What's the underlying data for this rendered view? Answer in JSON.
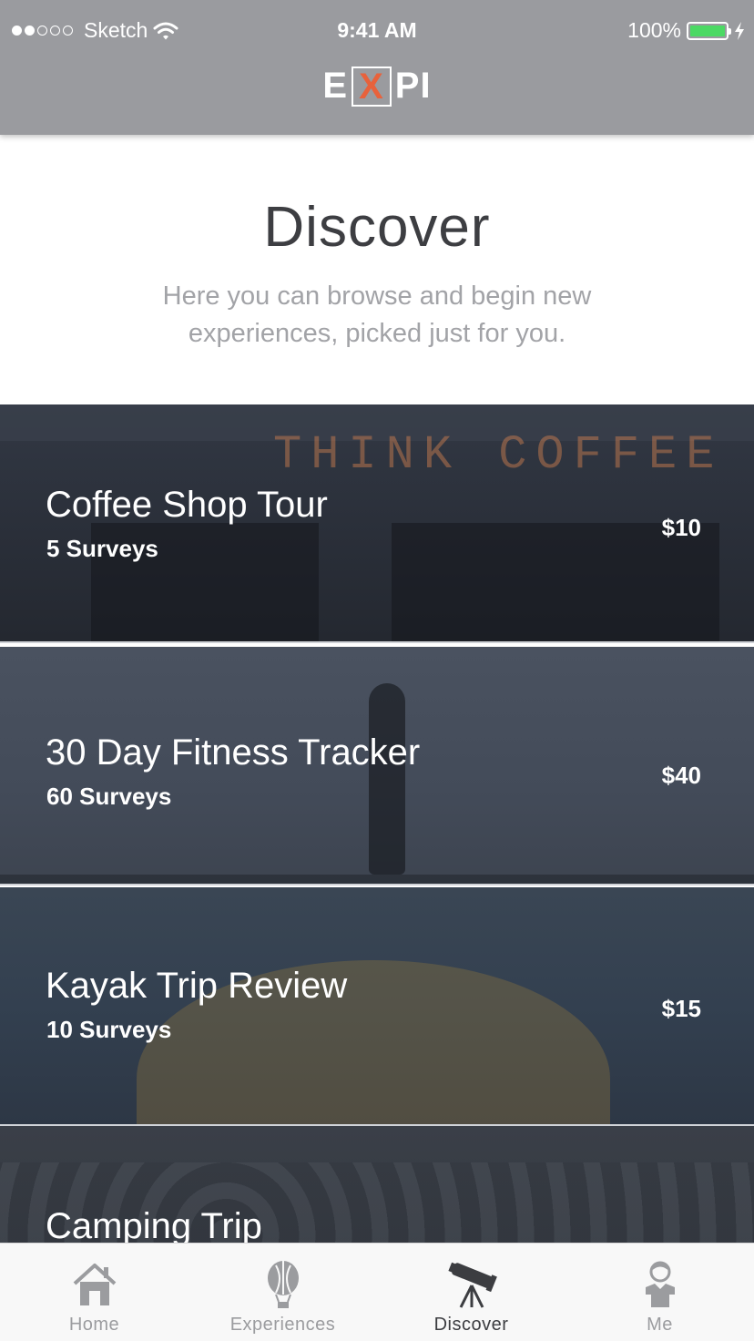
{
  "status_bar": {
    "carrier": "Sketch",
    "time": "9:41 AM",
    "battery": "100%"
  },
  "header": {
    "logo": {
      "left": "E",
      "boxed": "X",
      "right": "PI"
    }
  },
  "intro": {
    "title": "Discover",
    "description": "Here you can browse and begin new experiences, picked just for you."
  },
  "experiences": [
    {
      "title": "Coffee Shop Tour",
      "surveys": "5 Surveys",
      "price": "$10",
      "image_text": "THINK COFFEE"
    },
    {
      "title": "30 Day Fitness Tracker",
      "surveys": "60 Surveys",
      "price": "$40"
    },
    {
      "title": "Kayak Trip Review",
      "surveys": "10 Surveys",
      "price": "$15"
    },
    {
      "title": "Camping Trip",
      "surveys": "",
      "price": ""
    }
  ],
  "tabs": [
    {
      "label": "Home",
      "icon": "house-icon",
      "active": false
    },
    {
      "label": "Experiences",
      "icon": "hot-air-balloon-icon",
      "active": false
    },
    {
      "label": "Discover",
      "icon": "telescope-icon",
      "active": true
    },
    {
      "label": "Me",
      "icon": "person-icon",
      "active": false
    }
  ],
  "colors": {
    "header_bg": "#9a9b9f",
    "logo_accent": "#e8623c",
    "battery": "#4cd964",
    "active_tab": "#3c3d41",
    "inactive_tab": "#9b9c9f"
  }
}
